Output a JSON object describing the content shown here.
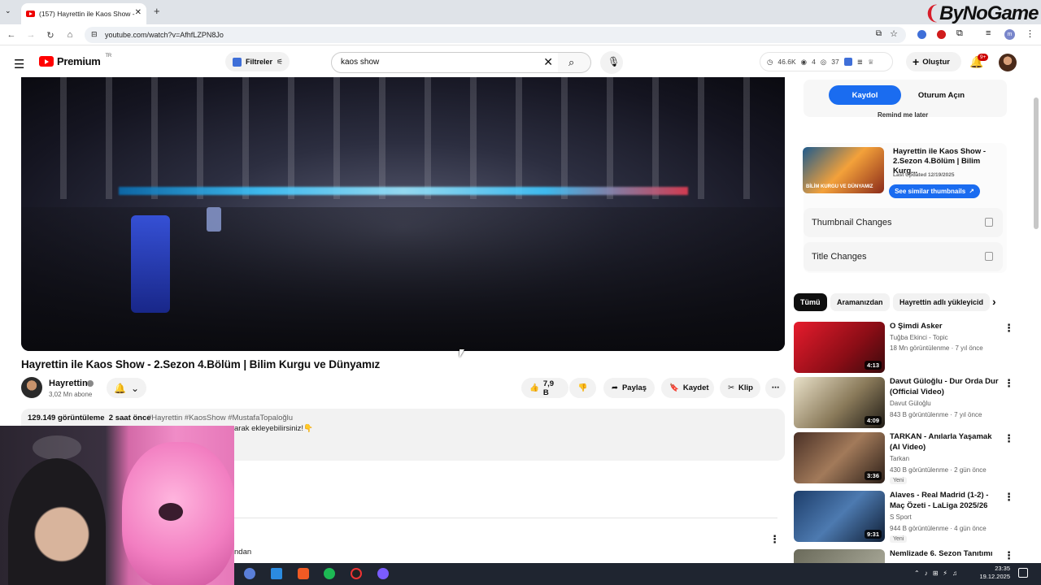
{
  "browser": {
    "tab_title": "(157) Hayrettin ile Kaos Show -",
    "url": "youtube.com/watch?v=AfhfLZPN8Jo",
    "watermark": "ByNoGame"
  },
  "yt_header": {
    "logo_text": "Premium",
    "logo_region": "TR",
    "filters_label": "Filtreler",
    "search_query": "kaos show",
    "stats": {
      "views": "46.6K",
      "a": "4",
      "b": "37"
    },
    "create_label": "Oluştur",
    "notif_badge": "9+"
  },
  "video": {
    "title": "Hayrettin ile Kaos Show - 2.Sezon 4.Bölüm | Bilim Kurgu ve Dünyamız",
    "channel": "Hayrettin",
    "subscribers": "3,02 Mn abone",
    "likes": "7,9 B",
    "share_label": "Paylaş",
    "save_label": "Kaydet",
    "clip_label": "Klip",
    "views": "129.149 görüntüleme",
    "age": "2 saat önce",
    "tags": "#Hayrettin #KaosShow #MustafaTopaloğlu",
    "desc_fragment": "arak ekleyebilirsiniz!👇",
    "below_fragment": "ndan"
  },
  "sidebar": {
    "signup_label": "Kaydol",
    "signin_label": "Oturum Açın",
    "remind_label": "Remind me later",
    "ext_title": "Hayrettin ile Kaos Show - 2.Sezon 4.Bölüm | Bilim Kurg...",
    "ext_updated": "Last Updated 12/19/2025",
    "ext_button": "See similar thumbnails",
    "thumb_text": "BİLİM KURGU VE DÜNYAMIZ",
    "acc1": "Thumbnail Changes",
    "acc2": "Title Changes",
    "chips": [
      "Tümü",
      "Aramanızdan",
      "Hayrettin adlı yükleyicid"
    ],
    "recs": [
      {
        "title": "O Şimdi Asker",
        "channel": "Tuğba Ekinci - Topic",
        "meta": "18 Mn görüntülenme · 7 yıl önce",
        "duration": "4:13",
        "badge": ""
      },
      {
        "title": "Davut Güloğlu - Dur Orda Dur (Official Video)",
        "channel": "Davut Güloğlu",
        "meta": "843 B görüntülenme · 7 yıl önce",
        "duration": "4:09",
        "badge": ""
      },
      {
        "title": "TARKAN - Anılarla Yaşamak (AI Video)",
        "channel": "Tarkan",
        "meta": "430 B görüntülenme · 2 gün önce",
        "duration": "3:36",
        "badge": "Yeni"
      },
      {
        "title": "Alaves - Real Madrid (1-2) - Maç Özeti - LaLiga 2025/26",
        "channel": "S Sport",
        "meta": "944 B görüntülenme · 4 gün önce",
        "duration": "9:31",
        "badge": "Yeni"
      },
      {
        "title": "Nemlizade 6. Sezon Tanıtımı",
        "channel": "",
        "meta": "",
        "duration": "",
        "badge": ""
      }
    ]
  },
  "taskbar": {
    "time": "23:35",
    "date": "19.12.2025"
  }
}
